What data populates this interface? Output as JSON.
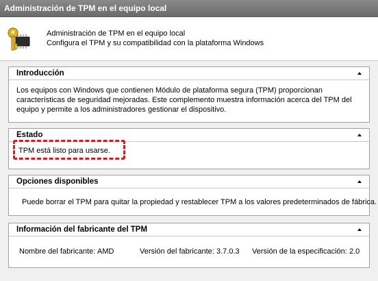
{
  "window": {
    "title": "Administración de TPM en el equipo local"
  },
  "header": {
    "line1": "Administración de TPM en el equipo local",
    "line2": "Configura el TPM y su compatibilidad con la plataforma Windows",
    "icon": "key-chip-icon"
  },
  "sections": {
    "intro": {
      "title": "Introducción",
      "text": "Los equipos con Windows que contienen Módulo de plataforma segura (TPM) proporcionan características de seguridad mejoradas. Este complemento muestra información acerca del TPM del equipo y permite a los administradores gestionar el dispositivo."
    },
    "status": {
      "title": "Estado",
      "text": "TPM está listo para usarse.",
      "highlight_color": "#d41c1c"
    },
    "options": {
      "title": "Opciones disponibles",
      "text": "Puede borrar el TPM para quitar la propiedad y restablecer TPM a los valores predeterminados de fábrica."
    },
    "manufacturer": {
      "title": "Información del fabricante del TPM",
      "name_label": "Nombre del fabricante:",
      "name_value": "AMD",
      "version_label": "Versión del fabricante:",
      "version_value": "3.7.0.3",
      "spec_label": "Versión de la especificación:",
      "spec_value": "2.0"
    }
  },
  "colors": {
    "titlebar": "#777777",
    "panel_bg": "#f0f0f0",
    "section_border": "#a0a0a0",
    "highlight": "#d41c1c"
  }
}
